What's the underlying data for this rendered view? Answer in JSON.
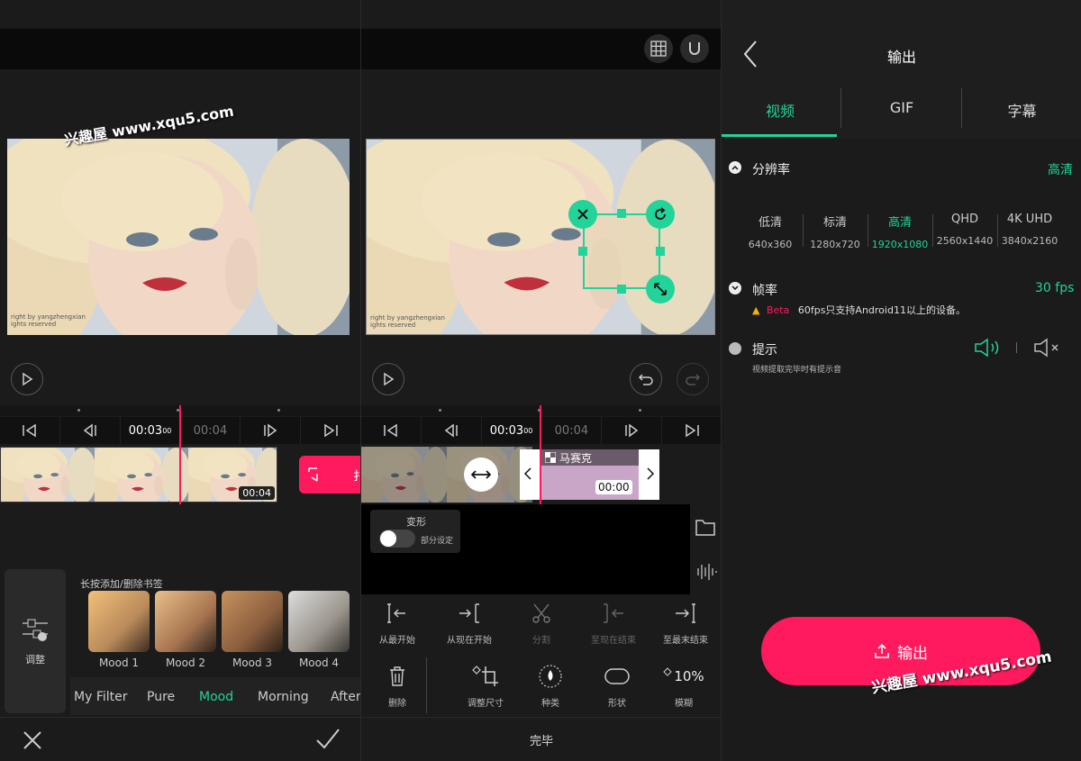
{
  "colors": {
    "accent_green": "#22d39a",
    "accent_pink": "#ff1a5e",
    "bg": "#1b1b1b"
  },
  "watermark": "兴趣屋 www.xqu5.com",
  "photo_caption": {
    "line1": "right by yangzhengxian",
    "line2": "ights reserved"
  },
  "left": {
    "time_current": "00:03",
    "time_current_frames": "00",
    "time_next": "00:04",
    "clip_duration": "00:04",
    "clip_side_label": "扌",
    "filter_hint": "长按添加/删除书签",
    "adjust_label": "调整",
    "filters": [
      {
        "name": "Mood 1"
      },
      {
        "name": "Mood 2"
      },
      {
        "name": "Mood 3"
      },
      {
        "name": "Mood 4"
      }
    ],
    "filter_tabs": [
      "My Filter",
      "Pure",
      "Mood",
      "Morning",
      "Aftern"
    ],
    "active_tab": "Mood"
  },
  "middle": {
    "time_current": "00:03",
    "time_current_frames": "00",
    "time_next": "00:04",
    "mosaic_label": "马赛克",
    "mosaic_time": "00:00",
    "transform_title": "变形",
    "transform_sub": "部分设定",
    "tools_row1": [
      "从最开始",
      "从现在开始",
      "分割",
      "至现在结束",
      "至最末结束"
    ],
    "tools_row2": [
      "删除",
      "调整尺寸",
      "种类",
      "形状",
      "模糊"
    ],
    "blur_value": "10%",
    "done_label": "完毕"
  },
  "right": {
    "title": "输出",
    "tabs": [
      "视频",
      "GIF",
      "字幕"
    ],
    "resolution_label": "分辨率",
    "resolution_value": "高清",
    "resolutions": [
      {
        "name": "低清",
        "size": "640x360"
      },
      {
        "name": "标清",
        "size": "1280x720"
      },
      {
        "name": "高清",
        "size": "1920x1080"
      },
      {
        "name": "QHD",
        "size": "2560x1440"
      },
      {
        "name": "4K UHD",
        "size": "3840x2160"
      }
    ],
    "framerate_label": "帧率",
    "framerate_value": "30 fps",
    "beta_label": "Beta",
    "framerate_note": "60fps只支持Android11以上的设备。",
    "hint_label": "提示",
    "hint_note": "视频提取完毕时有提示音",
    "export_button": "输出"
  }
}
